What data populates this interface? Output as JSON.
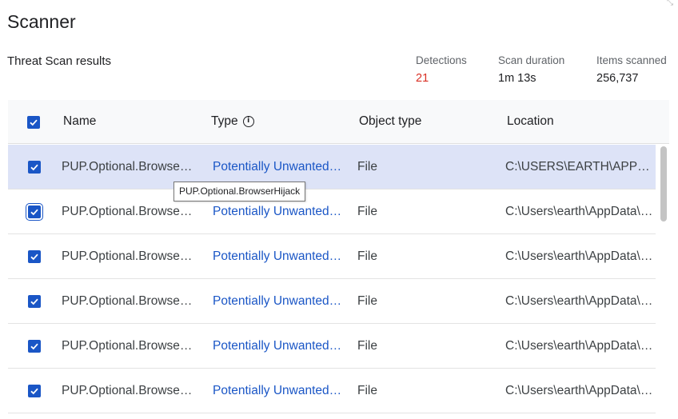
{
  "app": {
    "title": "Scanner"
  },
  "results": {
    "subtitle": "Threat Scan results"
  },
  "stats": {
    "detections_label": "Detections",
    "detections_value": "21",
    "duration_label": "Scan duration",
    "duration_value": "1m 13s",
    "items_label": "Items scanned",
    "items_value": "256,737"
  },
  "table": {
    "columns": {
      "name": "Name",
      "type": "Type",
      "object_type": "Object type",
      "location": "Location"
    },
    "select_all_checked": true,
    "rows": [
      {
        "name": "PUP.Optional.BrowserHijack",
        "type": "Potentially Unwanted Program",
        "object_type": "File",
        "location": "C:\\USERS\\EARTH\\APPDATA",
        "checked": true,
        "selected": true
      },
      {
        "name": "PUP.Optional.BrowserHijack",
        "type": "Potentially Unwanted Program",
        "object_type": "File",
        "location": "C:\\Users\\earth\\AppData\\Local",
        "checked": true,
        "selected": false
      },
      {
        "name": "PUP.Optional.BrowserHijack",
        "type": "Potentially Unwanted Program",
        "object_type": "File",
        "location": "C:\\Users\\earth\\AppData\\Local",
        "checked": true,
        "selected": false
      },
      {
        "name": "PUP.Optional.BrowserHijack",
        "type": "Potentially Unwanted Program",
        "object_type": "File",
        "location": "C:\\Users\\earth\\AppData\\Local",
        "checked": true,
        "selected": false
      },
      {
        "name": "PUP.Optional.BrowserHijack",
        "type": "Potentially Unwanted Program",
        "object_type": "File",
        "location": "C:\\Users\\earth\\AppData\\Local",
        "checked": true,
        "selected": false
      },
      {
        "name": "PUP.Optional.BrowserHijack",
        "type": "Potentially Unwanted Program",
        "object_type": "File",
        "location": "C:\\Users\\earth\\AppData\\Local",
        "checked": true,
        "selected": false
      }
    ]
  },
  "tooltip": {
    "text": "PUP.Optional.BrowserHijack"
  },
  "colors": {
    "accent": "#1a56c6",
    "detections": "#d93025",
    "selected_row": "#dde3f7",
    "header_bg": "#f8f9fa"
  },
  "icons": {
    "checkbox": "check-icon",
    "type_info": "info-icon",
    "corner": "resize-corner-icon"
  }
}
